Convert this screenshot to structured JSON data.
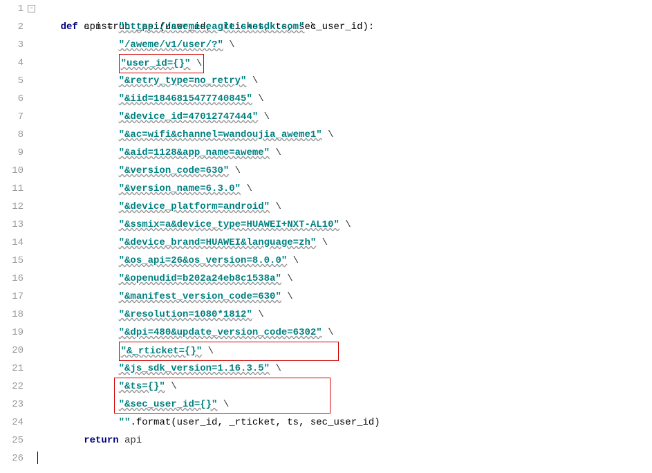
{
  "gutter": {
    "lines": [
      "1",
      "2",
      "3",
      "4",
      "5",
      "6",
      "7",
      "8",
      "9",
      "10",
      "11",
      "12",
      "13",
      "14",
      "15",
      "16",
      "17",
      "18",
      "19",
      "20",
      "21",
      "22",
      "23",
      "24",
      "25",
      "26"
    ]
  },
  "code": {
    "line1": {
      "keyword": "def ",
      "funcname": "construct_api",
      "params": "(user_id, _rticket, ts, sec_user_id):"
    },
    "line2": {
      "indent": "        ",
      "var": "api = ",
      "str": "\"https://aweme-eagle.snssdk.com\"",
      "cont": " \\"
    },
    "line3": {
      "indent": "              ",
      "str": "\"/aweme/v1/user/?\"",
      "cont": " \\"
    },
    "line4": {
      "indent": "              ",
      "str": "\"user_id={}\"",
      "cont": " \\"
    },
    "line5": {
      "indent": "              ",
      "str": "\"&retry_type=no_retry\"",
      "cont": " \\"
    },
    "line6": {
      "indent": "              ",
      "str": "\"&iid=1846815477740845\"",
      "cont": " \\"
    },
    "line7": {
      "indent": "              ",
      "str": "\"&device_id=47012747444\"",
      "cont": " \\"
    },
    "line8": {
      "indent": "              ",
      "str": "\"&ac=wifi&channel=wandoujia_aweme1\"",
      "cont": " \\"
    },
    "line9": {
      "indent": "              ",
      "str": "\"&aid=1128&app_name=aweme\"",
      "cont": " \\"
    },
    "line10": {
      "indent": "              ",
      "str": "\"&version_code=630\"",
      "cont": " \\"
    },
    "line11": {
      "indent": "              ",
      "str": "\"&version_name=6.3.0\"",
      "cont": " \\"
    },
    "line12": {
      "indent": "              ",
      "str": "\"&device_platform=android\"",
      "cont": " \\"
    },
    "line13": {
      "indent": "              ",
      "str": "\"&ssmix=a&device_type=HUAWEI+NXT-AL10\"",
      "cont": " \\"
    },
    "line14": {
      "indent": "              ",
      "str": "\"&device_brand=HUAWEI&language=zh\"",
      "cont": " \\"
    },
    "line15": {
      "indent": "              ",
      "str": "\"&os_api=26&os_version=8.0.0\"",
      "cont": " \\"
    },
    "line16": {
      "indent": "              ",
      "str": "\"&openudid=b202a24eb8c1538a\"",
      "cont": " \\"
    },
    "line17": {
      "indent": "              ",
      "str": "\"&manifest_version_code=630\"",
      "cont": " \\"
    },
    "line18": {
      "indent": "              ",
      "str": "\"&resolution=1080*1812\"",
      "cont": " \\"
    },
    "line19": {
      "indent": "              ",
      "str": "\"&dpi=480&update_version_code=6302\"",
      "cont": " \\"
    },
    "line20": {
      "indent": "              ",
      "str": "\"&_rticket={}\"",
      "cont": " \\"
    },
    "line21": {
      "indent": "              ",
      "str": "\"&js_sdk_version=1.16.3.5\"",
      "cont": " \\"
    },
    "line22": {
      "indent": "              ",
      "str": "\"&ts={}\"",
      "cont": " \\"
    },
    "line23": {
      "indent": "              ",
      "str": "\"&sec_user_id={}\"",
      "cont": " \\"
    },
    "line24": {
      "indent": "              ",
      "str": "\"\"",
      "method": ".format(user_id, _rticket, ts, sec_user_id)"
    },
    "line25": {
      "indent": "        ",
      "keyword": "return ",
      "var": "api"
    }
  }
}
